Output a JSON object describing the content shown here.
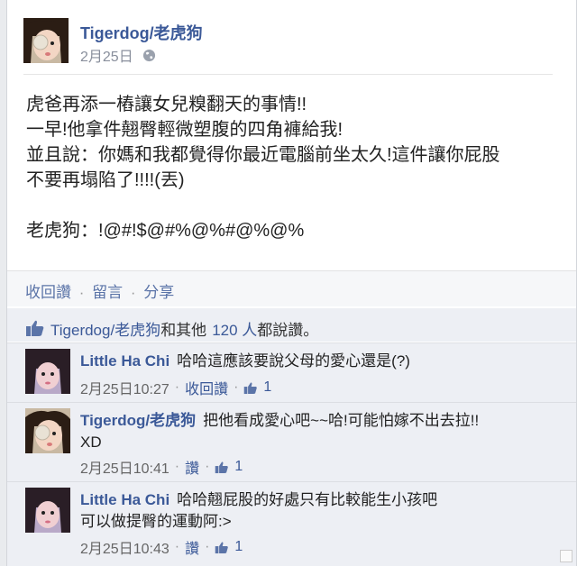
{
  "post": {
    "author": "Tigerdog/老虎狗",
    "date": "2月25日",
    "lines": [
      "虎爸再添一樁讓女兒糗翻天的事情!!",
      "一早!他拿件翹臀輕微塑腹的四角褲給我!",
      "並且說：你媽和我都覺得你最近電腦前坐太久!這件讓你屁股",
      "不要再塌陷了!!!!(丟)",
      "",
      "老虎狗：!@#!$@#%@%#@%@%"
    ]
  },
  "actions": {
    "unread": "收回讚",
    "comment": "留言",
    "share": "分享",
    "separator": "·"
  },
  "likes": {
    "name": "Tigerdog/老虎狗",
    "rest": "和其他",
    "count": "120 人",
    "suffix": "都說讚。"
  },
  "comments": [
    {
      "name": "Little Ha Chi",
      "text": "哈哈這應該要說父母的愛心還是(?)",
      "text2": "",
      "time": "2月25日10:27",
      "action": "收回讚",
      "likes": "1"
    },
    {
      "name": "Tigerdog/老虎狗",
      "text": "把他看成愛心吧~~哈!可能怕嫁不出去拉!!",
      "text2": "XD",
      "time": "2月25日10:41",
      "action": "讚",
      "likes": "1"
    },
    {
      "name": "Little Ha Chi",
      "text": "哈哈翹屁股的好處只有比較能生小孩吧",
      "text2": "可以做提臀的運動阿:>",
      "time": "2月25日10:43",
      "action": "讚",
      "likes": "1"
    }
  ],
  "colors": {
    "link": "#3b5998",
    "meta": "#898f9c",
    "comment_bg": "#edeff4"
  },
  "icons": {
    "privacy": "globe-icon",
    "like": "thumbs-up-icon"
  }
}
